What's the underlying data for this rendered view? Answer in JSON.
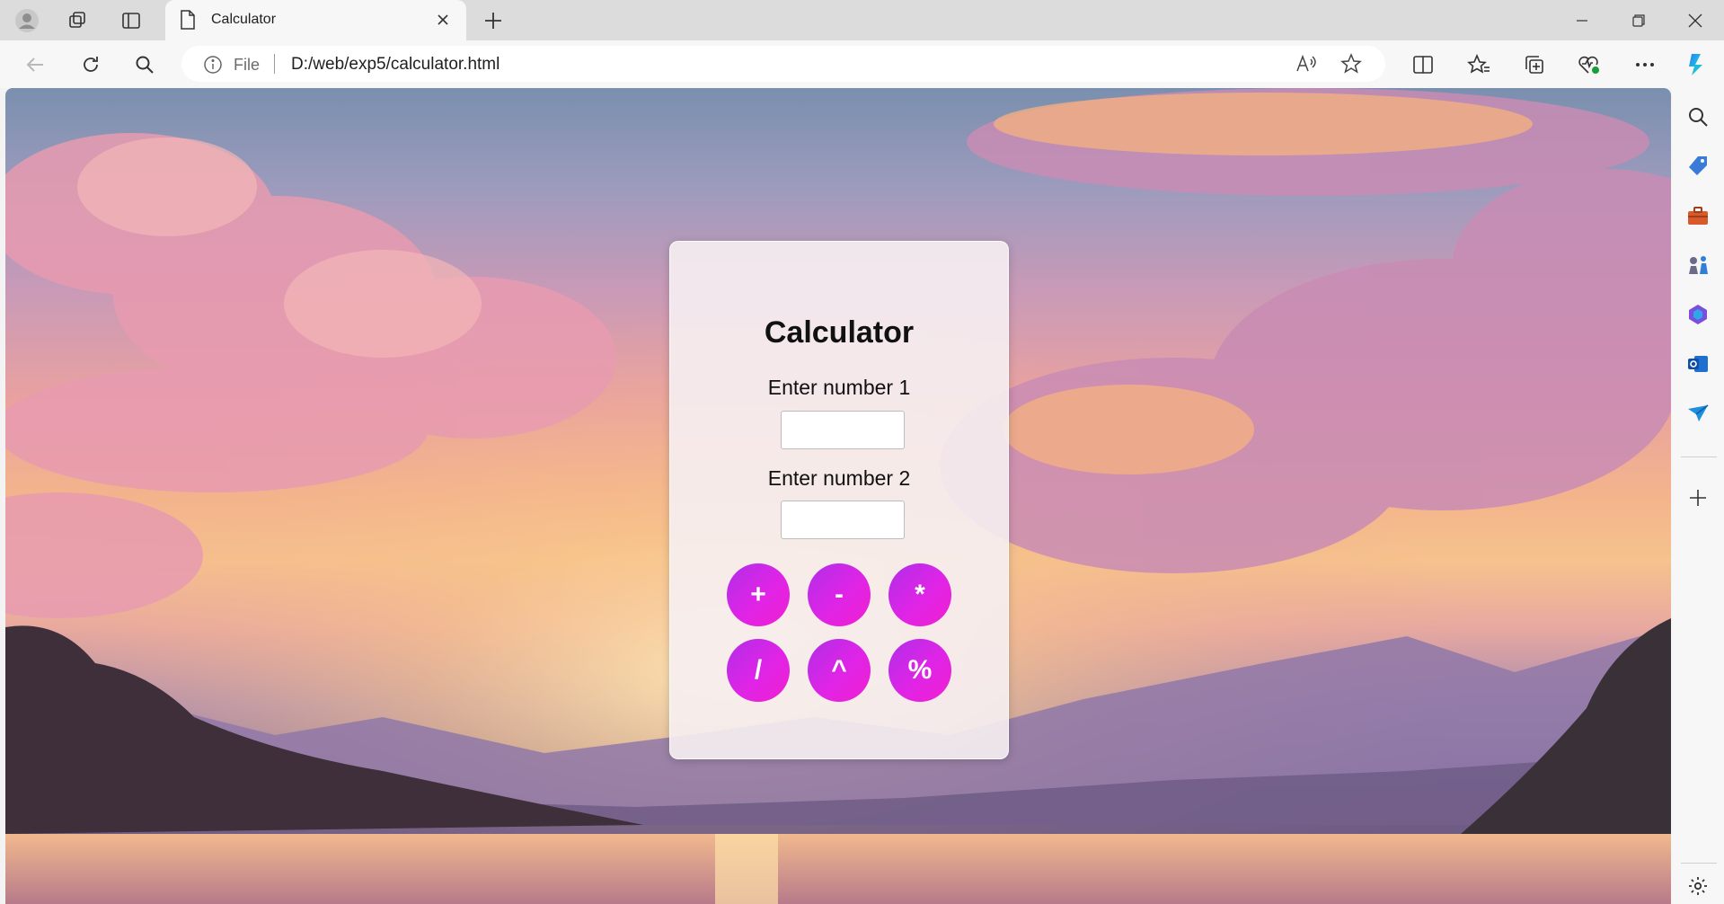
{
  "browser": {
    "tab": {
      "title": "Calculator"
    },
    "address": {
      "scheme_label": "File",
      "url": "D:/web/exp5/calculator.html"
    },
    "icons": {
      "tabstrip": [
        "profile-icon",
        "workspaces-icon",
        "vertical-tabs-icon"
      ],
      "toolbar": [
        "back-icon",
        "refresh-icon",
        "search-icon"
      ],
      "toolbar_right": [
        "split-screen-icon",
        "favorites-icon",
        "collections-icon",
        "browser-essentials-icon",
        "more-icon",
        "copilot-icon"
      ],
      "sidebar": [
        "search-icon",
        "shopping-tag-icon",
        "toolbox-icon",
        "games-icon",
        "m365-icon",
        "outlook-icon",
        "send-icon",
        "add-icon",
        "settings-icon"
      ]
    }
  },
  "calculator": {
    "title": "Calculator",
    "label1": "Enter number 1",
    "label2": "Enter number 2",
    "input1_value": "",
    "input2_value": "",
    "buttons": [
      "+",
      "-",
      "*",
      "/",
      "^",
      "%"
    ],
    "accent_color": "#d926e6"
  }
}
